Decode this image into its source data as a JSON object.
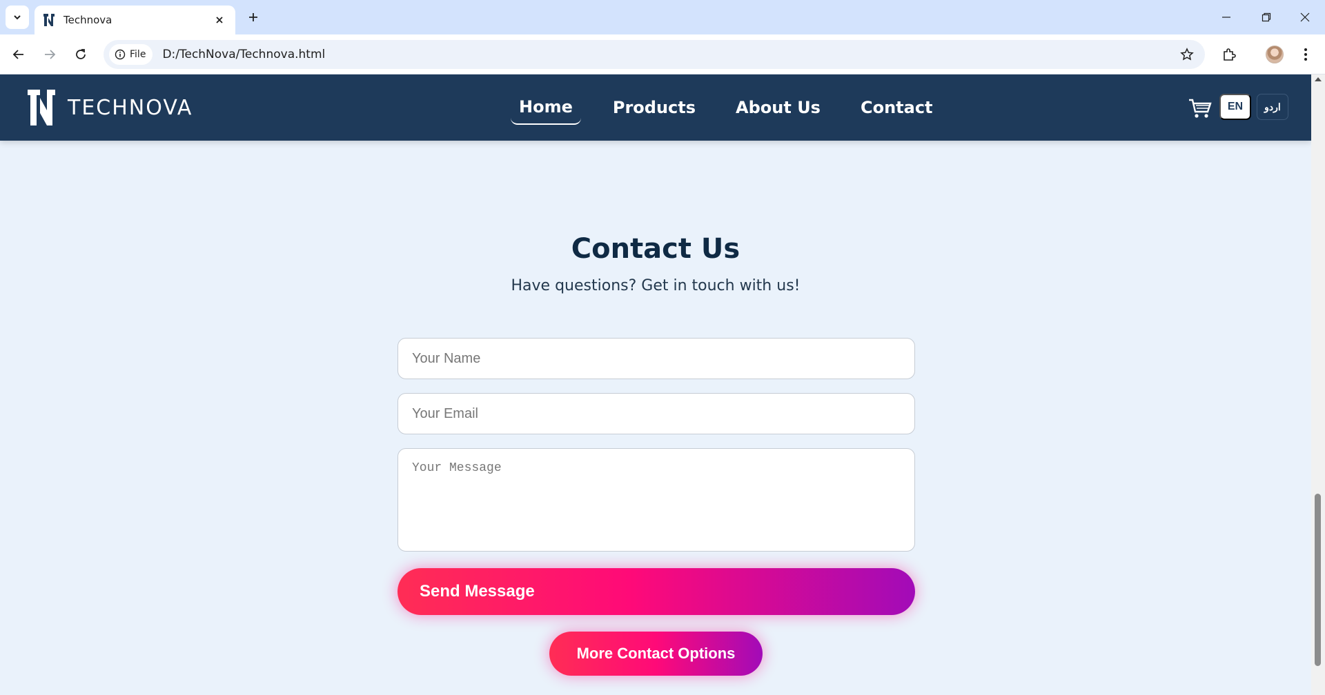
{
  "browser": {
    "tab_title": "Technova",
    "address_chip": "File",
    "url": "D:/TechNova/Technova.html"
  },
  "site": {
    "brand": "TECHNOVA",
    "nav": [
      {
        "label": "Home",
        "active": true
      },
      {
        "label": "Products",
        "active": false
      },
      {
        "label": "About Us",
        "active": false
      },
      {
        "label": "Contact",
        "active": false
      }
    ],
    "lang_en": "EN",
    "lang_ur": "اردو",
    "colors": {
      "nav_bg": "#1e3a5a",
      "page_bg": "#eaf2fb",
      "accent_start": "#ff2d55",
      "accent_end": "#a20bb8"
    }
  },
  "contact": {
    "title": "Contact Us",
    "subtitle": "Have questions? Get in touch with us!",
    "name_placeholder": "Your Name",
    "email_placeholder": "Your Email",
    "message_placeholder": "Your Message",
    "send_label": "Send Message",
    "more_label": "More Contact Options"
  },
  "icons": [
    "tab-search-icon",
    "technova-favicon",
    "close-icon",
    "plus-icon",
    "minimize-icon",
    "restore-icon",
    "window-close-icon",
    "back-arrow-icon",
    "forward-arrow-icon",
    "reload-icon",
    "info-icon",
    "star-icon",
    "extensions-icon",
    "profile-avatar",
    "more-vert-icon",
    "cart-icon"
  ]
}
